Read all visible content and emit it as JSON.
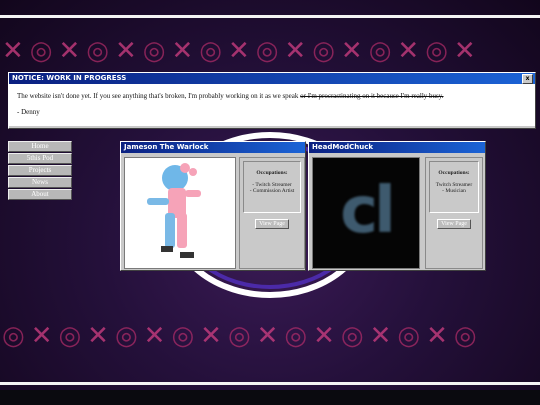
{
  "notice": {
    "title": "NOTICE: WORK IN PROGRESS",
    "close_label": "x",
    "message_main": "The website isn't done yet. If you see anything that's broken, I'm probably working on it as we speak ",
    "message_strike": "or I'm procrastinating on it because I'm really busy.",
    "signature": "- Denny"
  },
  "nav": {
    "items": [
      {
        "label": "Home"
      },
      {
        "label": "5this Pod"
      },
      {
        "label": "Projects"
      },
      {
        "label": "News"
      },
      {
        "label": "About"
      }
    ]
  },
  "cards": [
    {
      "title": "Jameson The Warlock",
      "occupations_label": "Occupations:",
      "occupations": [
        "- Twitch Streamer",
        "- Commission Artist"
      ],
      "button_label": "View Page"
    },
    {
      "title": "HeadModChuck",
      "occupations_label": "Occupations:",
      "occupations": [
        "Twitch Streamer",
        "- Musician"
      ],
      "button_label": "View Page",
      "logo_text": "cl"
    }
  ],
  "colors": {
    "titlebar": "#0b2b8c",
    "window": "#c9c9c9",
    "pattern_pink": "#d23f83"
  }
}
